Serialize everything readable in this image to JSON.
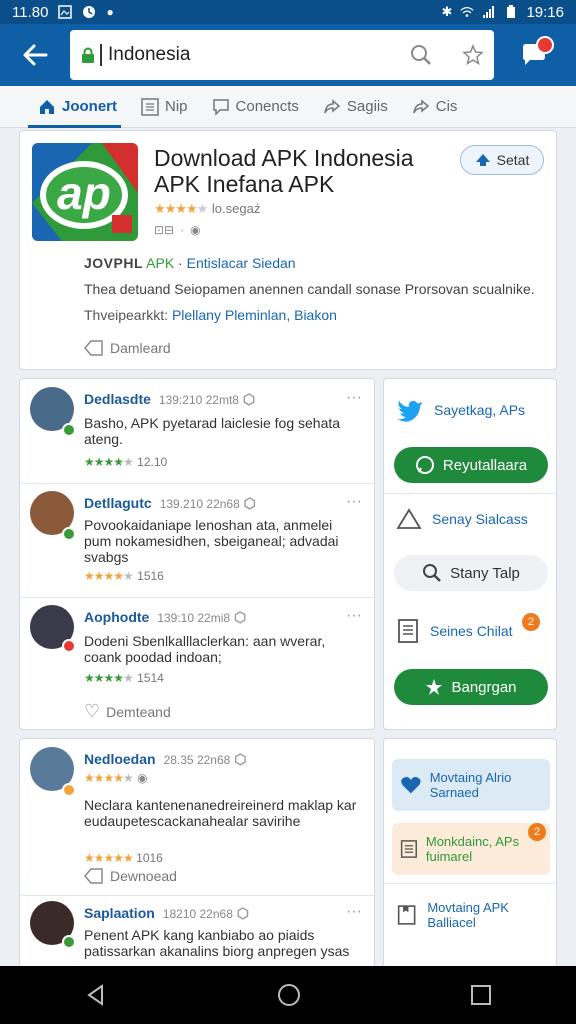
{
  "status_bar": {
    "time_left": "11.80",
    "time_right": "19:16"
  },
  "search": {
    "url": "Indonesia"
  },
  "tabs": [
    {
      "label": "Joonert"
    },
    {
      "label": "Nip"
    },
    {
      "label": "Conencts"
    },
    {
      "label": "Sagiis"
    },
    {
      "label": "Cis"
    }
  ],
  "app": {
    "title": "Download APK Indonesia APK Inefana APK",
    "rating_text": "lo.segaź",
    "rating_value": 4.5,
    "follow_label": "Setat",
    "brand_prefix": "JOVPHL",
    "brand_apk": "APK",
    "brand_link": "Entislacar Siedan",
    "description": "Thea detuand Seiopamen anennen candall sonase Prorsovan scualnike.",
    "tags_label": "Thveipearkkt:",
    "tags_links": "Plellany Pleminlan, Biakon",
    "download_label": "Damleard",
    "logo_text": "ap",
    "colors": {
      "brand_blue": "#0e5fa6",
      "green": "#2f9a3a",
      "orange": "#f2a33a"
    }
  },
  "reviews": [
    {
      "name": "Dedlasdte",
      "time": "139:210 22mt8",
      "text": "Basho, APK pyetarad laiclesie fog sehata ateng.",
      "rating": "12.10",
      "avatar_color": "#4a6a8a"
    },
    {
      "name": "Detllagutc",
      "time": "139.210 22n68",
      "text": "Povookaidaniape lenoshan ata, anmelei pum nokamesidhen, sbeiganeal; advadai svabgs",
      "rating": "1516",
      "avatar_color": "#8a5a3a"
    },
    {
      "name": "Aophodte",
      "time": "139:10 22mi8",
      "text": "Dodeni Sbenlkalllaclerkan: aan wverar, coank poodad indoan;",
      "rating": "1514",
      "avatar_color": "#3a3a4a"
    },
    {
      "name": "Nedloedan",
      "time": "28.35 22n68",
      "text": "Neclara kantenenanedreireinerd maklap kar eudaupetescackanahealar savirihe",
      "rating": "1016",
      "avatar_color": "#5a7a9a"
    },
    {
      "name": "Saplaation",
      "time": "18210 22n68",
      "text": "Penent APK kang kanbiabo ao piaids patissarkan akanalins biorg anpregen ysas",
      "rating": "",
      "avatar_color": "#3a2a2a"
    }
  ],
  "review_download_labels": {
    "first": "Demteand",
    "second": "Dewnoead"
  },
  "sidebar": {
    "twitter": "Sayetkag, APs",
    "green_btn": "Reyutallaara",
    "sales": "Senay Sialcass",
    "search_btn": "Stany Talp",
    "series": "Seines Chilat",
    "series_badge": "2",
    "big_btn": "Bangrgan",
    "tile1": "Movtaing Alrio Sarnaed",
    "tile2": "Monkdainc, APs fuimarel",
    "tile2_badge": "2",
    "tile3": "Movtaing APK Balliacel"
  }
}
